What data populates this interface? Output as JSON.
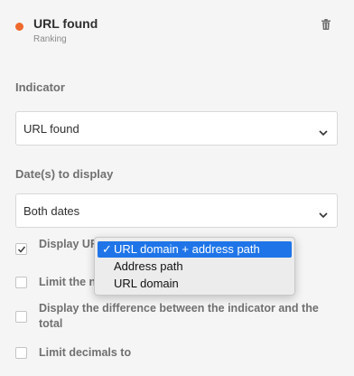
{
  "header": {
    "title": "URL found",
    "subtitle": "Ranking",
    "dot_color": "#ee6a2e",
    "delete_icon": "trash-icon"
  },
  "indicator": {
    "label": "Indicator",
    "value": "URL found"
  },
  "dates": {
    "label": "Date(s) to display",
    "value": "Both dates"
  },
  "options": {
    "display_url": {
      "label": "Display UR",
      "checked": true
    },
    "limit": {
      "label": "Limit the n",
      "checked": false
    },
    "difference": {
      "label": "Display the difference between the indicator and the total",
      "checked": false
    },
    "decimals": {
      "label": "Limit decimals to",
      "checked": false
    }
  },
  "dropdown": {
    "items": [
      {
        "label": "URL domain + address path",
        "selected": true
      },
      {
        "label": "Address path",
        "selected": false
      },
      {
        "label": "URL domain",
        "selected": false
      }
    ],
    "selected_check": "✓",
    "highlight_color": "#1f75e8"
  }
}
